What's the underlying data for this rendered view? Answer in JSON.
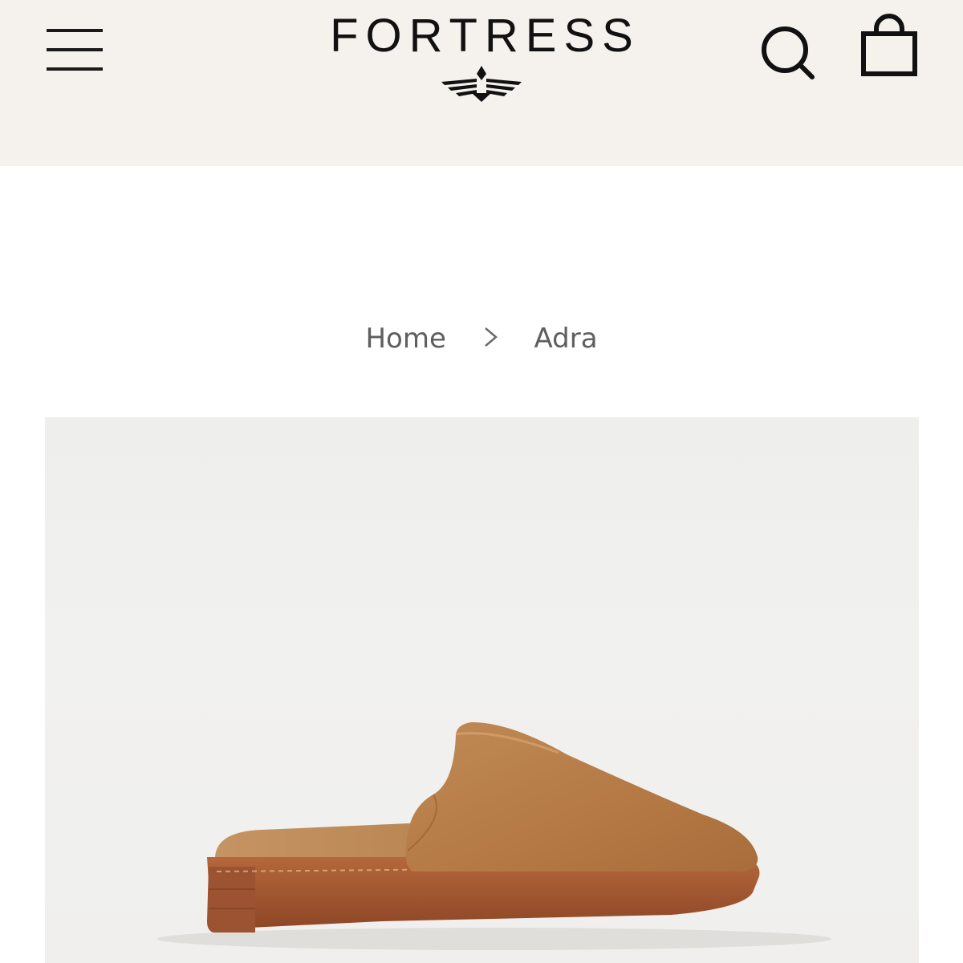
{
  "header": {
    "brand_name": "FORTRESS",
    "background_color": "#f5f1ed",
    "menu_icon": "hamburger-menu-icon",
    "search_icon": "search-icon",
    "cart_icon": "shopping-bag-icon"
  },
  "breadcrumb": {
    "items": [
      {
        "label": "Home"
      },
      {
        "label": "Adra"
      }
    ],
    "separator_icon": "chevron-right-icon"
  },
  "product": {
    "image_subject": "tan leather mule slipper",
    "accent_color": "#b57a45",
    "sole_color": "#a4542e"
  }
}
